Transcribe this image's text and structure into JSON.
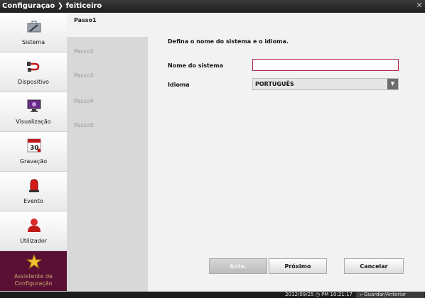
{
  "titlebar": {
    "title": "Configuraçao ❯ feiticeiro"
  },
  "sidebar": {
    "items": [
      {
        "label": "Sistema",
        "icon": "briefcase-wrench-icon"
      },
      {
        "label": "Dispositivo",
        "icon": "cable-plug-icon"
      },
      {
        "label": "Visualização",
        "icon": "monitor-icon"
      },
      {
        "label": "Gravação",
        "icon": "calendar-30-icon"
      },
      {
        "label": "Evento",
        "icon": "alarm-siren-icon"
      },
      {
        "label": "Utilizador",
        "icon": "user-icon"
      },
      {
        "label": "Assistente de Configuração",
        "icon": "wizard-star-icon"
      }
    ]
  },
  "steps": [
    "Passo1",
    "Passo2",
    "Passo3",
    "Passo4",
    "Passo5"
  ],
  "main": {
    "intro": "Defina o nome do sistema e o idioma.",
    "system_name_label": "Nome do sistema",
    "system_name_value": "",
    "language_label": "Idioma",
    "language_value": "PORTUGUÊS"
  },
  "buttons": {
    "prev": "Ante.",
    "next": "Próximo",
    "cancel": "Cancelar"
  },
  "status": {
    "datetime": "2012/09/25  ◷ PM 10:21:17",
    "save": "⤶ Guardar/Anterior"
  },
  "colors": {
    "accent": "#5a1035",
    "titlebar": "#2a2a2a",
    "input_border": "#b02a4a"
  }
}
